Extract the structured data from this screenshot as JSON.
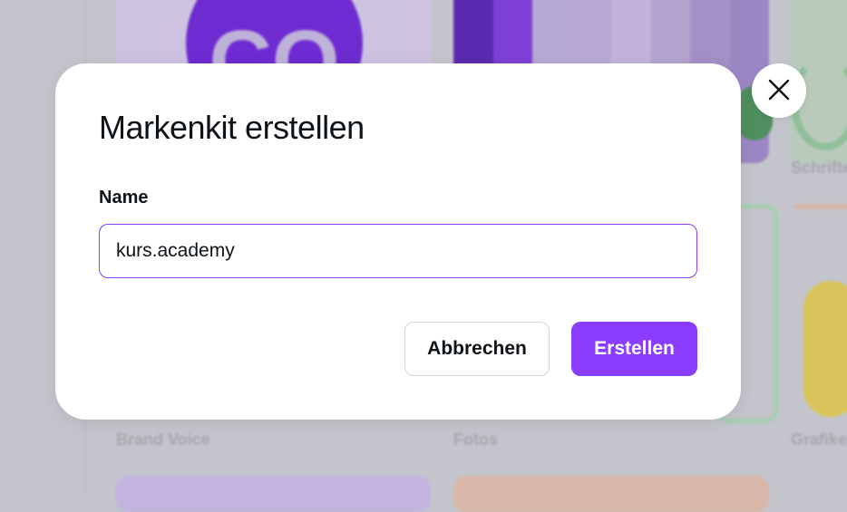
{
  "background": {
    "logo_text": "CO",
    "labels": {
      "brand_voice": "Brand Voice",
      "fotos": "Fotos",
      "grafiken": "Grafiken",
      "schriften": "Schriften"
    },
    "swatches": [
      "#5a2bb0",
      "#7d3fd6",
      "#b7a9d6",
      "#b8a9d4",
      "#c2b3da",
      "#b3a3cf",
      "#a48fc6",
      "#9c86c4"
    ]
  },
  "dialog": {
    "title": "Markenkit erstellen",
    "name_label": "Name",
    "name_value": "kurs.academy",
    "cancel_label": "Abbrechen",
    "create_label": "Erstellen"
  },
  "colors": {
    "accent": "#8b3dff",
    "text": "#0e1318"
  },
  "icons": {
    "close": "close-icon"
  }
}
